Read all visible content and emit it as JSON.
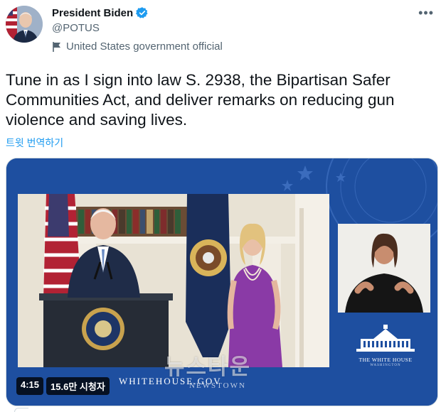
{
  "tweet": {
    "display_name": "President Biden",
    "handle": "@POTUS",
    "account_label": "United States government official",
    "text": "Tune in as I sign into law S. 2938, the Bipartisan Safer Communities Act, and deliver remarks on reducing gun violence and saving lives.",
    "translate_link": "트윗 번역하기",
    "more_icon": "more-icon"
  },
  "media": {
    "duration": "4:15",
    "views": "15.6만 시청자",
    "brand_text": "WHITEHOUSE.GOV",
    "wh_label": "THE WHITE HOUSE",
    "wh_sub": "WASHINGTON"
  },
  "watermark": {
    "title": "뉴스타운",
    "sub": "NEWSTOWN"
  },
  "colors": {
    "link": "#1d9bf0",
    "verified": "#1d9bf0",
    "muted": "#536471",
    "media_bg": "#1e4fa0"
  }
}
